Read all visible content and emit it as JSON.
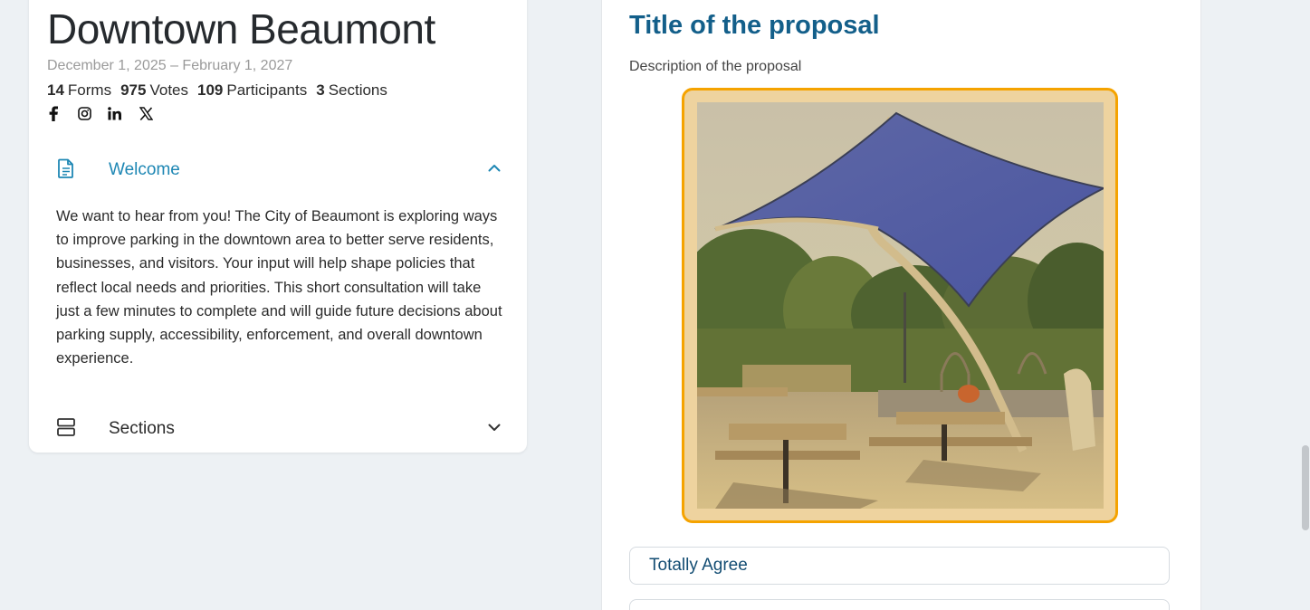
{
  "consultation": {
    "title": "Downtown Beaumont",
    "date_range": "December 1, 2025 – February 1, 2027",
    "stats": [
      {
        "value": "14",
        "label": "Forms"
      },
      {
        "value": "975",
        "label": "Votes"
      },
      {
        "value": "109",
        "label": "Participants"
      },
      {
        "value": "3",
        "label": "Sections"
      }
    ],
    "social_icons": [
      "facebook-icon",
      "instagram-icon",
      "linkedin-icon",
      "x-icon"
    ]
  },
  "welcome": {
    "label": "Welcome",
    "icon": "document-icon",
    "expanded": true,
    "text": "We want to hear from you! The City of Beaumont is exploring ways to improve parking in the downtown area to better serve residents, businesses, and visitors. Your input will help shape policies that reflect local needs and priorities. This short consultation will take just a few minutes to complete and will guide future decisions about parking supply, accessibility, enforcement, and overall downtown experience."
  },
  "sections": {
    "label": "Sections",
    "icon": "sections-icon",
    "expanded": false
  },
  "proposal": {
    "title": "Title of the proposal",
    "description": "Description of the proposal",
    "highlight_color": "#f5a300",
    "answers": [
      "Totally Agree",
      ""
    ]
  },
  "colors": {
    "accent_link": "#1e87b4",
    "proposal_title": "#135f8a",
    "page_background": "#edf1f4"
  }
}
